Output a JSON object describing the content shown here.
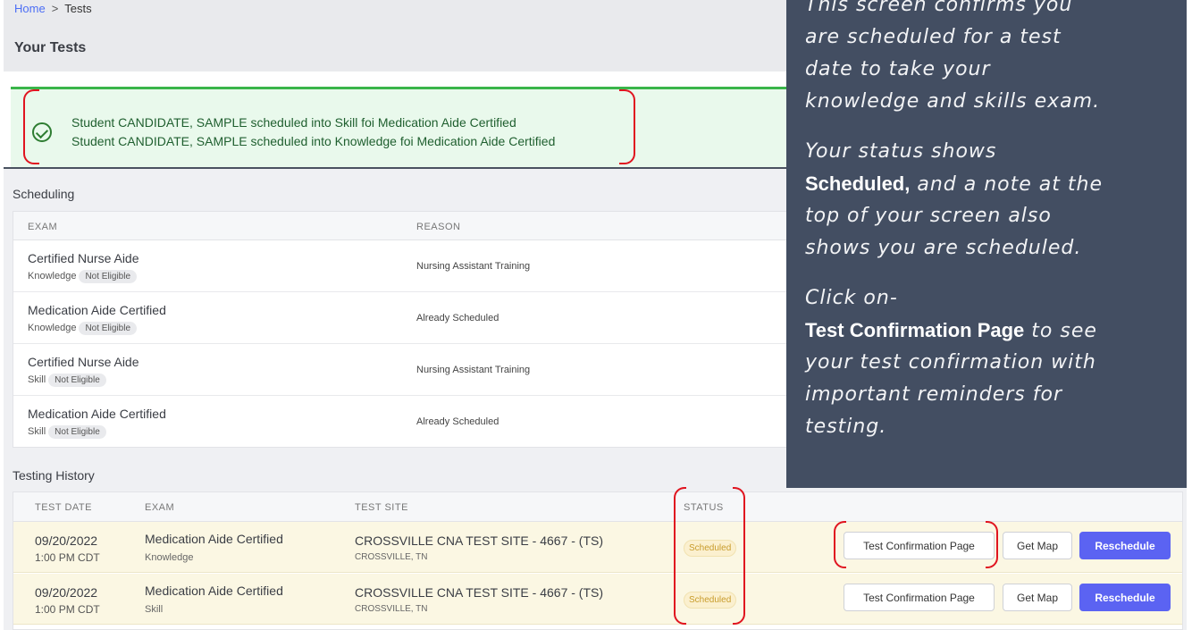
{
  "breadcrumb": {
    "home": "Home",
    "separator": ">",
    "current": "Tests"
  },
  "page_title": "Your Tests",
  "banner": {
    "line1": "Student CANDIDATE, SAMPLE scheduled into Skill foi Medication Aide Certified",
    "line2": "Student CANDIDATE, SAMPLE scheduled into Knowledge foi Medication Aide Certified"
  },
  "scheduling": {
    "title": "Scheduling",
    "headers": {
      "exam": "EXAM",
      "reason": "REASON"
    },
    "rows": [
      {
        "exam": "Certified Nurse Aide",
        "type": "Knowledge",
        "badge": "Not Eligible",
        "reason": "Nursing Assistant Training"
      },
      {
        "exam": "Medication Aide Certified",
        "type": "Knowledge",
        "badge": "Not Eligible",
        "reason": "Already Scheduled"
      },
      {
        "exam": "Certified Nurse Aide",
        "type": "Skill",
        "badge": "Not Eligible",
        "reason": "Nursing Assistant Training"
      },
      {
        "exam": "Medication Aide Certified",
        "type": "Skill",
        "badge": "Not Eligible",
        "reason": "Already Scheduled"
      }
    ]
  },
  "history": {
    "title": "Testing History",
    "headers": {
      "date": "TEST DATE",
      "exam": "EXAM",
      "site": "TEST SITE",
      "status": "STATUS"
    },
    "rows": [
      {
        "date": "09/20/2022",
        "time": "1:00 PM CDT",
        "exam": "Medication Aide Certified",
        "type": "Knowledge",
        "site": "CROSSVILLE CNA TEST SITE - 4667 - (TS)",
        "city": "CROSSVILLE, TN",
        "status": "Scheduled"
      },
      {
        "date": "09/20/2022",
        "time": "1:00 PM CDT",
        "exam": "Medication Aide Certified",
        "type": "Skill",
        "site": "CROSSVILLE CNA TEST SITE - 4667 - (TS)",
        "city": "CROSSVILLE, TN",
        "status": "Scheduled"
      }
    ],
    "actions": {
      "confirm": "Test Confirmation Page",
      "map": "Get Map",
      "reschedule": "Reschedule"
    }
  },
  "tip": {
    "l1": "This screen confirms you",
    "l2": "are scheduled for a test",
    "l3": "date to take your",
    "l4": "knowledge and skills exam.",
    "l5": "Your status shows",
    "l6_bold": "Scheduled,",
    "l6_rest": " and a note at the",
    "l7": "top of your screen also",
    "l8": "shows you are scheduled.",
    "l9": "Click on-",
    "l10_bold": "Test Confirmation Page",
    "l10_rest": " to see",
    "l11": "your test confirmation with",
    "l12": "important reminders for",
    "l13": "testing."
  },
  "colors": {
    "accent": "#5b63f2",
    "success": "#3ab54a",
    "callout": "#e0141f",
    "overlay": "#434e62"
  }
}
